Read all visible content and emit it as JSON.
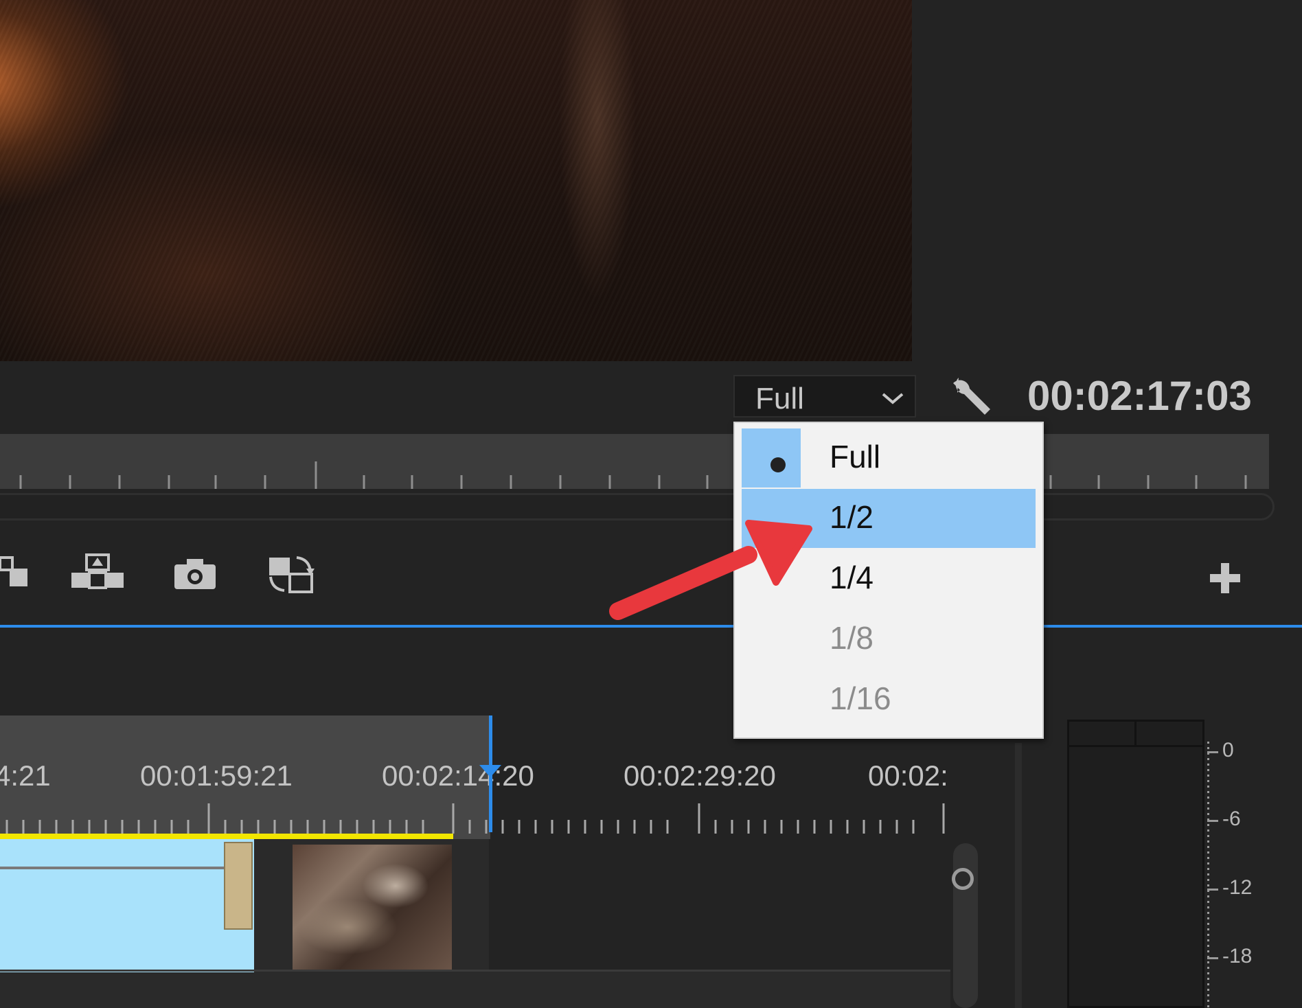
{
  "monitor": {
    "resolution_selected": "Full",
    "timecode": "00:02:17:03"
  },
  "resolution_menu": {
    "items": [
      {
        "label": "Full",
        "checked": true,
        "enabled": true
      },
      {
        "label": "1/2",
        "highlighted": true,
        "enabled": true
      },
      {
        "label": "1/4",
        "enabled": true
      },
      {
        "label": "1/8",
        "enabled": false
      },
      {
        "label": "1/16",
        "enabled": false
      }
    ]
  },
  "transport_icons": [
    "overwrite-icon",
    "export-frame-layout-icon",
    "camera-icon",
    "swap-icon",
    "plus-icon"
  ],
  "timeline": {
    "timecodes": [
      "4:21",
      "00:01:59:21",
      "00:02:14:20",
      "00:02:29:20",
      "00:02:"
    ]
  },
  "audio_meter": {
    "scale": [
      "0",
      "-6",
      "-12",
      "-18"
    ]
  },
  "colors": {
    "accent_blue": "#2d8ceb",
    "menu_highlight": "#8ec6f5",
    "arrow_red": "#e8383d",
    "work_area_yellow": "#f2e600"
  }
}
